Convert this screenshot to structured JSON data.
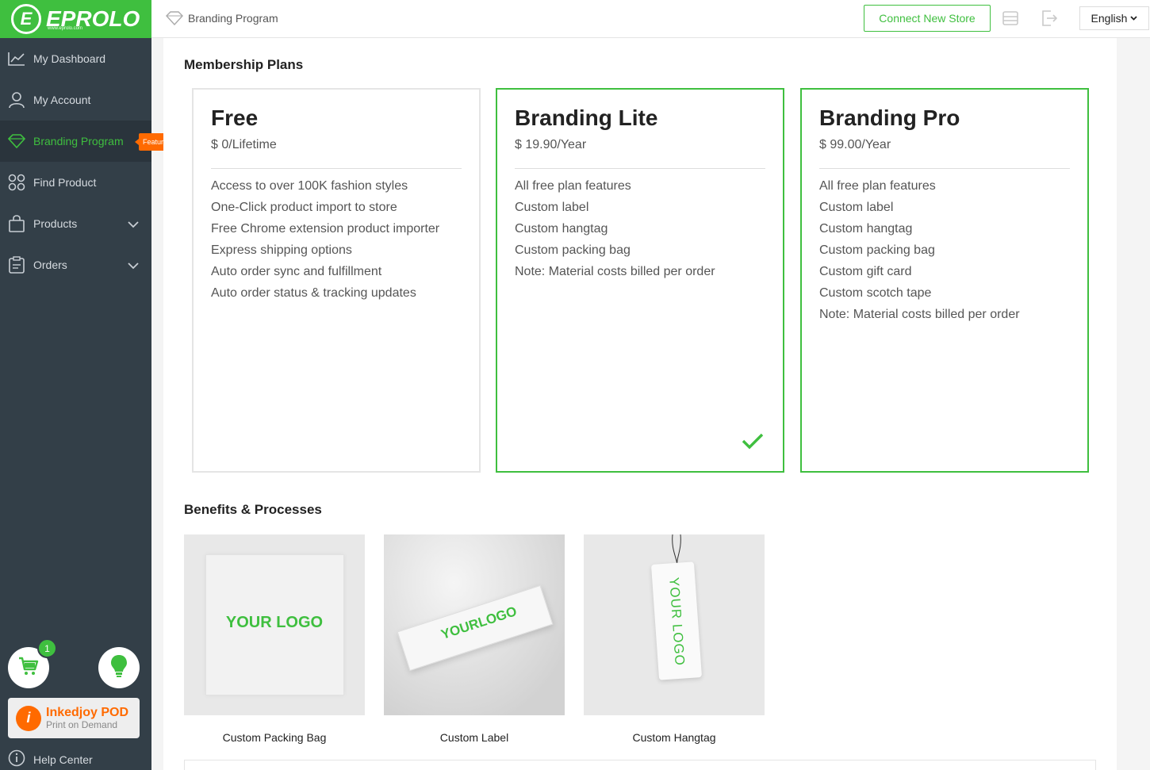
{
  "app": {
    "logo_text": "EPROLO",
    "logo_sub": "www.eprolo.com"
  },
  "sidebar": {
    "items": [
      {
        "label": "My Dashboard"
      },
      {
        "label": "My Account"
      },
      {
        "label": "Branding Program"
      },
      {
        "label": "Find Product"
      },
      {
        "label": "Products"
      },
      {
        "label": "Orders"
      }
    ],
    "featured_badge": "Featured",
    "cart_count": "1",
    "inkedjoy_title": "Inkedjoy POD",
    "inkedjoy_sub": "Print on Demand",
    "help_label": "Help Center"
  },
  "header": {
    "breadcrumb": "Branding Program",
    "connect_label": "Connect New Store",
    "language": "English"
  },
  "main": {
    "plans_title": "Membership Plans",
    "plans": [
      {
        "name": "Free",
        "price": "$ 0/Lifetime",
        "features": [
          "Access to over 100K fashion styles",
          "One-Click product import to store",
          "Free Chrome extension product importer",
          "Express shipping options",
          "Auto order sync and fulfillment",
          "Auto order status & tracking updates"
        ]
      },
      {
        "name": "Branding Lite",
        "price": "$ 19.90/Year",
        "features": [
          "All free plan features",
          "Custom label",
          "Custom hangtag",
          "Custom packing bag",
          "Note: Material costs billed per order"
        ]
      },
      {
        "name": "Branding Pro",
        "price": "$ 99.00/Year",
        "features": [
          "All free plan features",
          "Custom label",
          "Custom hangtag",
          "Custom packing bag",
          "Custom gift card",
          "Custom scotch tape",
          "Note: Material costs billed per order"
        ]
      }
    ],
    "benefits_title": "Benefits & Processes",
    "benefits": [
      {
        "caption": "Custom Packing Bag",
        "logo_text": "YOUR LOGO"
      },
      {
        "caption": "Custom Label",
        "logo_text": "YOURLOGO"
      },
      {
        "caption": "Custom Hangtag",
        "logo_text": "YOUR LOGO"
      }
    ]
  },
  "colors": {
    "brand_green": "#3fbf3f",
    "sidebar_bg": "#333f48",
    "featured_orange": "#ff6a00"
  }
}
